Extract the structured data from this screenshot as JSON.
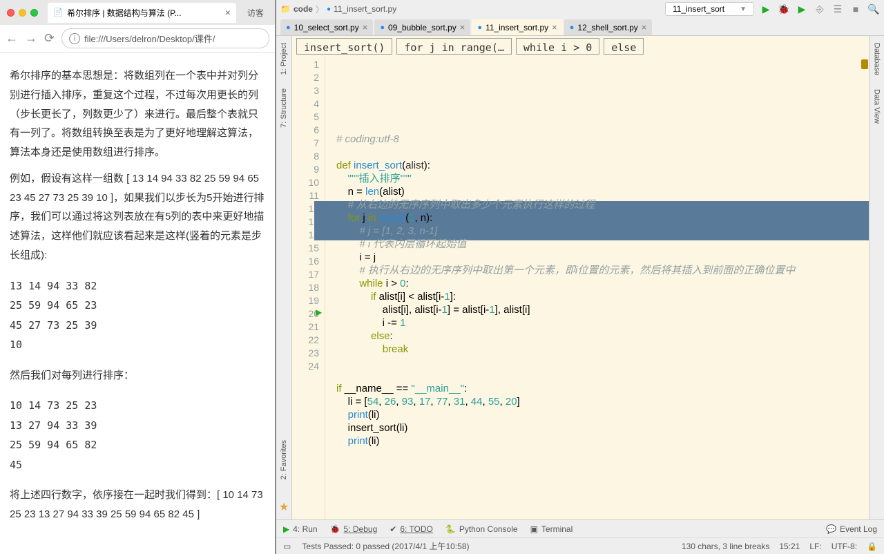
{
  "browser": {
    "tab_title": "希尔排序 | 数据结构与算法 (P...",
    "visit_label": "访客",
    "address": "file:///Users/delron/Desktop/课件/",
    "doc": {
      "p1": "希尔排序的基本思想是：将数组列在一个表中并对列分别进行插入排序，重复这个过程，不过每次用更长的列（步长更长了，列数更少了）来进行。最后整个表就只有一列了。将数组转换至表是为了更好地理解这算法，算法本身还是使用数组进行排序。",
      "p2": "例如，假设有这样一组数 [ 13 14 94 33 82 25 59 94 65 23 45 27 73 25 39 10 ]，如果我们以步长为5开始进行排序，我们可以通过将这列表放在有5列的表中来更好地描述算法，这样他们就应该看起来是这样(竖着的元素是步长组成):",
      "pre1": "13 14 94 33 82\n25 59 94 65 23\n45 27 73 25 39\n10",
      "p3": "然后我们对每列进行排序：",
      "pre2": "10 14 73 25 23\n13 27 94 33 39\n25 59 94 65 82\n45",
      "p4": "将上述四行数字，依序接在一起时我们得到：[ 10 14 73 25 23 13 27 94 33 39 25 59 94 65 82 45 ]"
    }
  },
  "ide": {
    "crumb_folder": "code",
    "crumb_file": "11_insert_sort.py",
    "run_config": "11_insert_sort",
    "tabs": [
      {
        "name": "10_select_sort.py",
        "active": false
      },
      {
        "name": "09_bubble_sort.py",
        "active": false
      },
      {
        "name": "11_insert_sort.py",
        "active": true
      },
      {
        "name": "12_shell_sort.py",
        "active": false
      }
    ],
    "bc": [
      "insert_sort()",
      "for j in range(…",
      "while i > 0",
      "else"
    ],
    "left_tools": [
      "1: Project",
      "7: Structure",
      "2: Favorites"
    ],
    "right_tools": [
      "Database",
      "Data View"
    ],
    "code_lines": [
      {
        "n": 1,
        "html": "<span class='c-comment'># coding:utf-8</span>"
      },
      {
        "n": 2,
        "html": ""
      },
      {
        "n": 3,
        "html": "<span class='c-kw'>def</span> <span class='c-def'>insert_sort</span>(<span class='c-param'>alist</span>):"
      },
      {
        "n": 4,
        "html": "    <span class='c-str'>\"\"\"插入排序\"\"\"</span>"
      },
      {
        "n": 5,
        "html": "    n = <span class='c-def'>len</span>(alist)"
      },
      {
        "n": 6,
        "html": "    <span class='c-comment'># 从右边的无序序列中取出多少个元素执行这样的过程</span>"
      },
      {
        "n": 7,
        "html": "    <span class='c-kw'>for</span> j <span class='c-kw'>in</span> <span class='c-def'>range</span>(<span class='c-num'>1</span>, n):"
      },
      {
        "n": 8,
        "html": "        <span class='c-comment'># j = [1, 2, 3, n-1]</span>"
      },
      {
        "n": 9,
        "html": "        <span class='c-comment'># i 代表内层循环起始值</span>"
      },
      {
        "n": 10,
        "html": "        i = j"
      },
      {
        "n": 11,
        "html": "        <span class='c-comment'># 执行从右边的无序序列中取出第一个元素，即i位置的元素，然后将其插入到前面的正确位置中</span>"
      },
      {
        "n": 12,
        "html": "        <span class='c-kw'>while</span> i > <span class='c-num'>0</span>:"
      },
      {
        "n": 13,
        "html": "            <span class='c-kw'>if</span> alist[i] < alist[i-<span class='c-num'>1</span>]:"
      },
      {
        "n": 14,
        "html": "                alist[i], alist[i-<span class='c-num'>1</span>] = alist[i-<span class='c-num'>1</span>], alist[i]"
      },
      {
        "n": 15,
        "html": "                i -= <span class='c-num'>1</span>"
      },
      {
        "n": 16,
        "html": "            <span class='c-kw'>else</span>:"
      },
      {
        "n": 17,
        "html": "                <span class='c-kw'>break</span>"
      },
      {
        "n": 18,
        "html": ""
      },
      {
        "n": 19,
        "html": ""
      },
      {
        "n": 20,
        "html": "<span class='c-kw'>if</span> __name__ == <span class='c-str'>\"__main__\"</span>:"
      },
      {
        "n": 21,
        "html": "    li = [<span class='c-num'>54</span>, <span class='c-num'>26</span>, <span class='c-num'>93</span>, <span class='c-num'>17</span>, <span class='c-num'>77</span>, <span class='c-num'>31</span>, <span class='c-num'>44</span>, <span class='c-num'>55</span>, <span class='c-num'>20</span>]"
      },
      {
        "n": 22,
        "html": "    <span class='c-def'>print</span>(li)"
      },
      {
        "n": 23,
        "html": "    insert_sort(li)"
      },
      {
        "n": 24,
        "html": "    <span class='c-def'>print</span>(li)"
      }
    ],
    "bottom": {
      "run": "4: Run",
      "debug": "5: Debug",
      "todo": "6: TODO",
      "console": "Python Console",
      "terminal": "Terminal",
      "eventlog": "Event Log"
    },
    "status": {
      "tests": "Tests Passed: 0 passed (2017/4/1 上午10:58)",
      "chars": "130 chars, 3 line breaks",
      "pos": "15:21",
      "sep": "LF:",
      "enc": "UTF-8:",
      "lock": "🔒"
    }
  }
}
